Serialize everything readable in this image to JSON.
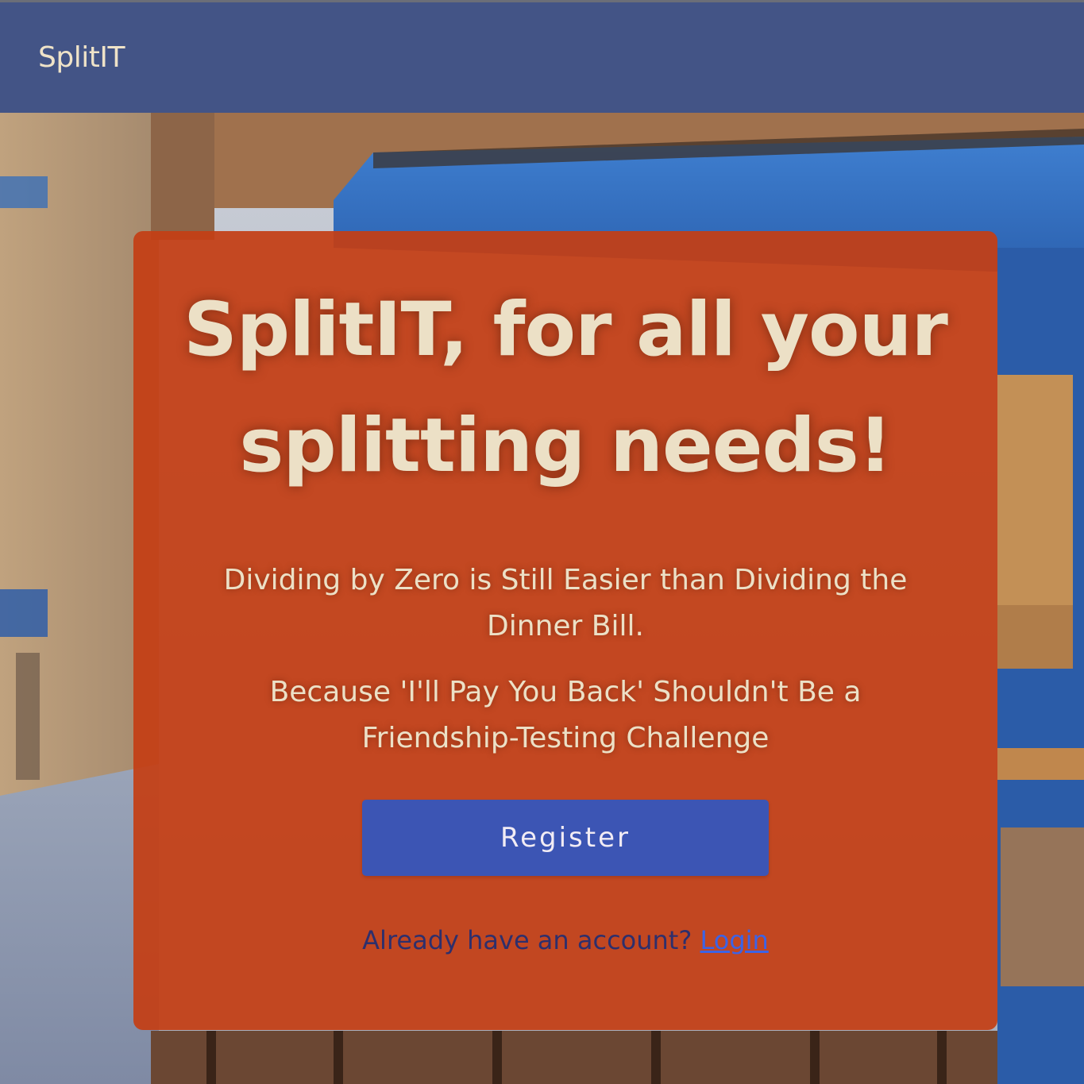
{
  "app": {
    "brand": "SplitIT"
  },
  "hero": {
    "headline": "SplitIT, for all your splitting needs!",
    "tagline_1": "Dividing by Zero is Still Easier than Dividing the Dinner Bill.",
    "tagline_2": "Because 'I'll Pay You Back' Shouldn't Be a Friendship-Testing Challenge",
    "register_label": "Register",
    "login_prompt": "Already have an account?",
    "login_label": "Login"
  },
  "colors": {
    "topbar": "#435486",
    "card": "#c43e14",
    "button": "#3c55b4",
    "link": "#3c63e6",
    "text": "#ece0c6"
  },
  "background": {
    "description_icon": "painted-cafe-street-image"
  }
}
